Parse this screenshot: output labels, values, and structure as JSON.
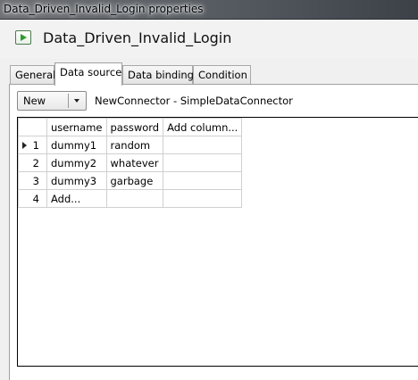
{
  "window": {
    "title": "Data_Driven_Invalid_Login properties"
  },
  "header": {
    "icon": "test-case-icon",
    "title": "Data_Driven_Invalid_Login"
  },
  "tabs": [
    {
      "label": "General",
      "active": false
    },
    {
      "label": "Data source",
      "active": true
    },
    {
      "label": "Data binding",
      "active": false
    },
    {
      "label": "Condition",
      "active": false
    }
  ],
  "datasource": {
    "select_value": "New",
    "connector_text": "NewConnector  -  SimpleDataConnector"
  },
  "grid": {
    "columns": [
      "username",
      "password",
      "Add column..."
    ],
    "rows": [
      {
        "num": "1",
        "username": "dummy1",
        "password": "random",
        "extra": ""
      },
      {
        "num": "2",
        "username": "dummy2",
        "password": "whatever",
        "extra": ""
      },
      {
        "num": "3",
        "username": "dummy3",
        "password": "garbage",
        "extra": ""
      },
      {
        "num": "4",
        "username": "Add...",
        "password": "",
        "extra": ""
      }
    ]
  }
}
